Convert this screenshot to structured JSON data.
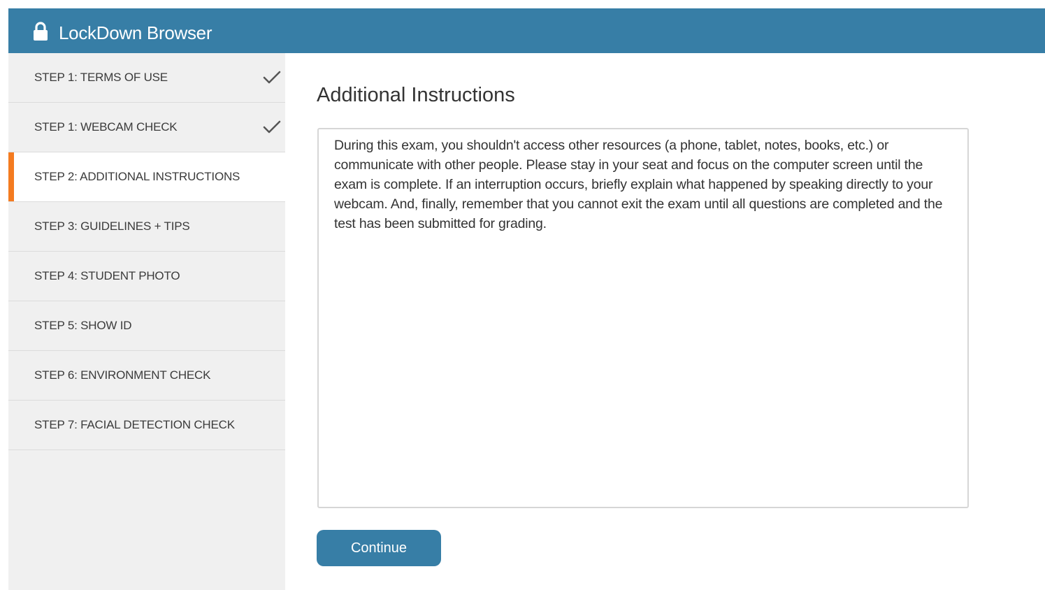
{
  "app": {
    "title": "LockDown Browser",
    "icon": "lock-icon",
    "colors": {
      "header": "#377ea6",
      "active_step_accent": "#f47b20",
      "button": "#377ea6"
    }
  },
  "sidebar": {
    "steps": [
      {
        "label": "STEP 1: TERMS OF USE",
        "completed": true,
        "active": false
      },
      {
        "label": "STEP 1: WEBCAM CHECK",
        "completed": true,
        "active": false
      },
      {
        "label": "STEP 2: ADDITIONAL INSTRUCTIONS",
        "completed": false,
        "active": true
      },
      {
        "label": "STEP 3: GUIDELINES + TIPS",
        "completed": false,
        "active": false
      },
      {
        "label": "STEP 4: STUDENT PHOTO",
        "completed": false,
        "active": false
      },
      {
        "label": "STEP 5: SHOW ID",
        "completed": false,
        "active": false
      },
      {
        "label": "STEP 6: ENVIRONMENT CHECK",
        "completed": false,
        "active": false
      },
      {
        "label": "STEP 7: FACIAL DETECTION CHECK",
        "completed": false,
        "active": false
      }
    ]
  },
  "main": {
    "title": "Additional Instructions",
    "instructions": "During this exam, you shouldn't access other resources (a phone, tablet, notes, books, etc.) or communicate with other people. Please stay in your seat and focus on the computer screen until the exam is complete. If an interruption occurs, briefly explain what happened by speaking directly to your webcam. And, finally, remember that you cannot exit the exam until all questions are completed and the test has been submitted for grading.",
    "continue_label": "Continue"
  }
}
